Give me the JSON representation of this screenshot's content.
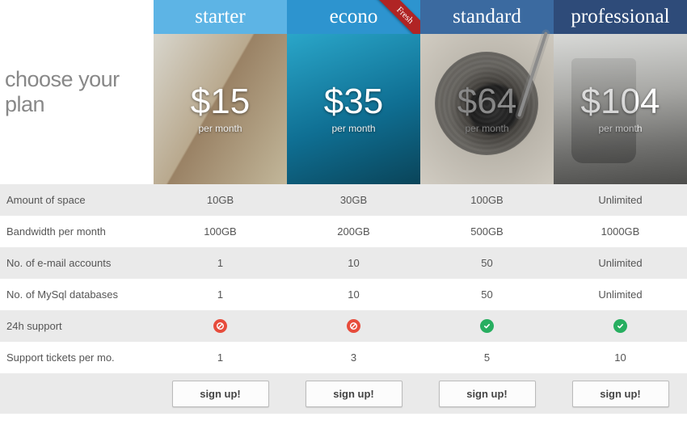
{
  "heading": "choose your plan",
  "ribbon": "Fresh",
  "period": "per month",
  "signup_label": "sign up!",
  "plans": [
    {
      "key": "starter",
      "title": "starter",
      "price": "$15"
    },
    {
      "key": "econo",
      "title": "econo",
      "price": "$35",
      "ribbon": true
    },
    {
      "key": "standard",
      "title": "standard",
      "price": "$64"
    },
    {
      "key": "professional",
      "title": "professional",
      "price": "$104"
    }
  ],
  "features": [
    {
      "label": "Amount of space",
      "values": [
        "10GB",
        "30GB",
        "100GB",
        "Unlimited"
      ]
    },
    {
      "label": "Bandwidth per month",
      "values": [
        "100GB",
        "200GB",
        "500GB",
        "1000GB"
      ]
    },
    {
      "label": "No. of e-mail accounts",
      "values": [
        "1",
        "10",
        "50",
        "Unlimited"
      ]
    },
    {
      "label": "No. of MySql databases",
      "values": [
        "1",
        "10",
        "50",
        "Unlimited"
      ]
    },
    {
      "label": "24h support",
      "values": [
        "no",
        "no",
        "yes",
        "yes"
      ],
      "icons": true
    },
    {
      "label": "Support tickets per mo.",
      "values": [
        "1",
        "3",
        "5",
        "10"
      ]
    }
  ]
}
